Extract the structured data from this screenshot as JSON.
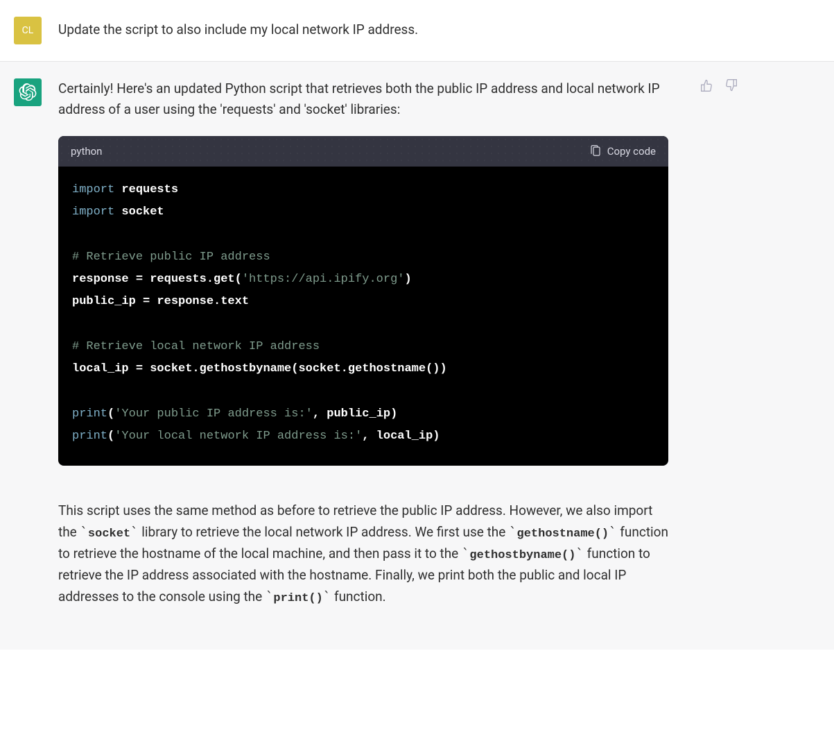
{
  "user": {
    "avatar_initials": "CL",
    "message": "Update the script to also include my local network IP address."
  },
  "assistant": {
    "intro": "Certainly! Here's an updated Python script that retrieves both the public IP address and local network IP address of a user using the 'requests' and 'socket' libraries:",
    "code": {
      "language": "python",
      "copy_label": "Copy code",
      "tokens": [
        [
          [
            "kw",
            "import"
          ],
          [
            "sp",
            " "
          ],
          [
            "id",
            "requests"
          ]
        ],
        [
          [
            "kw",
            "import"
          ],
          [
            "sp",
            " "
          ],
          [
            "id",
            "socket"
          ]
        ],
        [],
        [
          [
            "cm",
            "# Retrieve public IP address"
          ]
        ],
        [
          [
            "id",
            "response = requests.get("
          ],
          [
            "st",
            "'https://api.ipify.org'"
          ],
          [
            "id",
            ")"
          ]
        ],
        [
          [
            "id",
            "public_ip = response.text"
          ]
        ],
        [],
        [
          [
            "cm",
            "# Retrieve local network IP address"
          ]
        ],
        [
          [
            "id",
            "local_ip = socket.gethostbyname(socket.gethostname())"
          ]
        ],
        [],
        [
          [
            "kw",
            "print"
          ],
          [
            "id",
            "("
          ],
          [
            "st",
            "'Your public IP address is:'"
          ],
          [
            "id",
            ", public_ip)"
          ]
        ],
        [
          [
            "kw",
            "print"
          ],
          [
            "id",
            "("
          ],
          [
            "st",
            "'Your local network IP address is:'"
          ],
          [
            "id",
            ", local_ip)"
          ]
        ]
      ]
    },
    "explain": {
      "p1a": "This script uses the same method as before to retrieve the public IP address. However, we also import the ",
      "c1": "socket",
      "p1b": " library to retrieve the local network IP address. We first use the ",
      "c2": "gethostname()",
      "p1c": " function to retrieve the hostname of the local machine, and then pass it to the ",
      "c3": "gethostbyname()",
      "p1d": " function to retrieve the IP address associated with the hostname. Finally, we print both the public and local IP addresses to the console using the ",
      "c4": "print()",
      "p1e": " function."
    }
  }
}
